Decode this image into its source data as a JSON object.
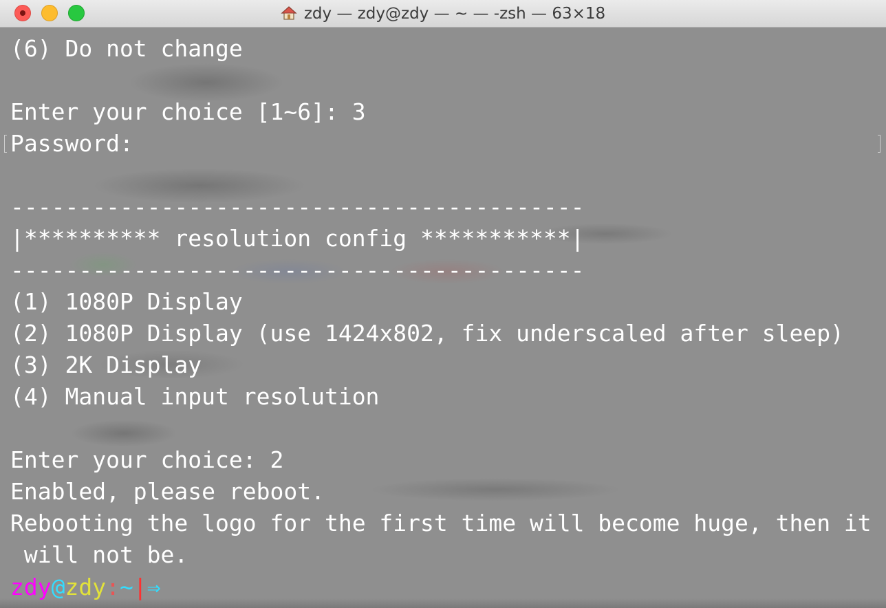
{
  "window": {
    "title": "zdy — zdy@zdy — ~ — -zsh — 63×18",
    "title_icon": "home-icon",
    "traffic_lights": {
      "close": "#fc5b57",
      "minimize": "#fdbc2e",
      "zoom": "#28c840"
    }
  },
  "terminal": {
    "text_color": "#ffffff",
    "background_color": "#8f8f8f",
    "lines": [
      "(6) Do not change",
      "",
      "Enter your choice [1~6]: 3",
      "Password:",
      "",
      "------------------------------------------",
      "|********** resolution config ***********|",
      "------------------------------------------",
      "(1) 1080P Display",
      "(2) 1080P Display (use 1424x802, fix underscaled after sleep)",
      "(3) 2K Display",
      "(4) Manual input resolution",
      "",
      "Enter your choice: 2",
      "Enabled, please reboot.",
      "Rebooting the logo for the first time will become huge, then it",
      " will not be."
    ],
    "prompt": {
      "user": "zdy",
      "at": "@",
      "host": "zdy",
      "colon": ":",
      "path": "~",
      "separator": "|",
      "arrow": "⇒",
      "colors": {
        "user": "#ff00ff",
        "at": "#33ddff",
        "host": "#e2e23a",
        "path": "#33ddff",
        "separator": "#ff3030",
        "arrow": "#33ddff"
      }
    }
  }
}
